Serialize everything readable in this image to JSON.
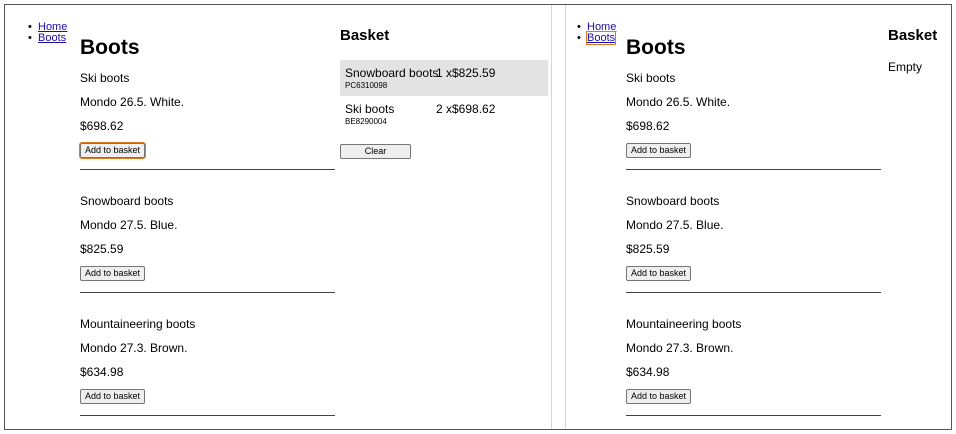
{
  "nav": {
    "home": "Home",
    "boots": "Boots"
  },
  "page_title": "Boots",
  "products": [
    {
      "name": "Ski boots",
      "desc": "Mondo 26.5. White.",
      "price": "$698.62",
      "button": "Add to basket"
    },
    {
      "name": "Snowboard boots",
      "desc": "Mondo 27.5. Blue.",
      "price": "$825.59",
      "button": "Add to basket"
    },
    {
      "name": "Mountaineering boots",
      "desc": "Mondo 27.3. Brown.",
      "price": "$634.98",
      "button": "Add to basket"
    }
  ],
  "basket": {
    "title": "Basket",
    "items": [
      {
        "name": "Snowboard boots",
        "qty": "1 x$825.59",
        "sku": "PC6310098"
      },
      {
        "name": "Ski boots",
        "qty": "2 x$698.62",
        "sku": "BE8290004"
      }
    ],
    "clear_label": "Clear",
    "empty_text": "Empty"
  },
  "colors": {
    "focus_ring": "#e4761b",
    "link": "#1a0dab",
    "highlight_row": "#e3e3e3"
  }
}
